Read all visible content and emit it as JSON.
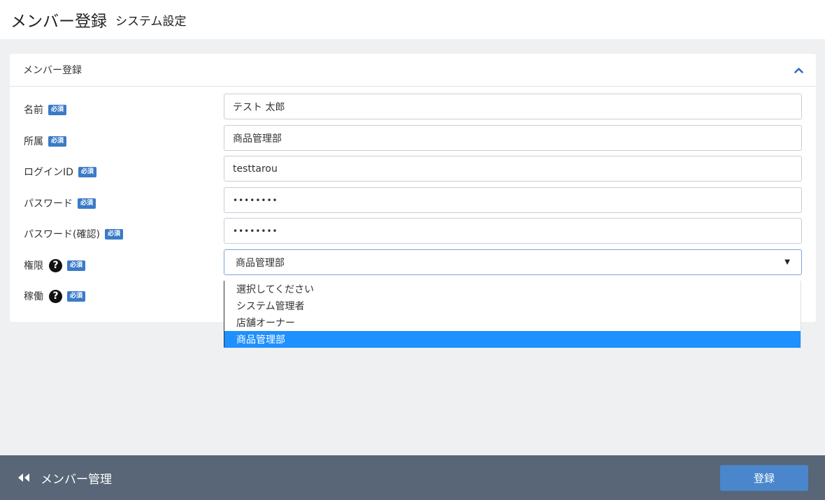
{
  "header": {
    "title": "メンバー登録",
    "subtitle": "システム設定"
  },
  "card": {
    "title": "メンバー登録"
  },
  "required_badge": "必須",
  "fields": {
    "name": {
      "label": "名前",
      "value": "テスト 太郎"
    },
    "department": {
      "label": "所属",
      "value": "商品管理部"
    },
    "login_id": {
      "label": "ログインID",
      "value": "testtarou"
    },
    "password": {
      "label": "パスワード",
      "value": "••••••••"
    },
    "password_confirm": {
      "label": "パスワード(確認)",
      "value": "••••••••"
    },
    "role": {
      "label": "権限",
      "value": "商品管理部"
    },
    "active": {
      "label": "稼働"
    }
  },
  "role_options": [
    "選択してください",
    "システム管理者",
    "店舗オーナー",
    "商品管理部"
  ],
  "role_selected_index": 3,
  "footer": {
    "back_label": "メンバー管理",
    "submit_label": "登録"
  },
  "colors": {
    "badge": "#3a7bc8",
    "selected_option": "#1e90ff",
    "footer_bg": "#586677",
    "submit": "#4a86cc"
  },
  "icons": {
    "collapse": "chevron-up-icon",
    "help": "question-circle-icon",
    "back": "double-left-arrow-icon",
    "select": "caret-down-icon"
  }
}
